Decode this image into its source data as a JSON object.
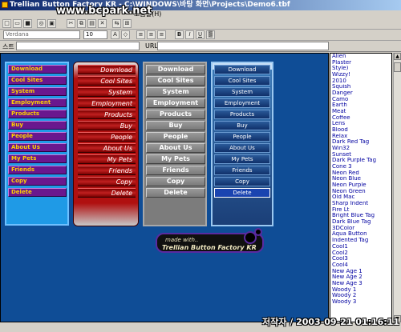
{
  "window": {
    "title": "Trellian Button Factory KR - C:\\WINDOWS\\바탕 화면\\Projects\\Demo6.tbf",
    "menu_tail": "도움말(H)"
  },
  "watermark": "www.bcpark.net",
  "toolbar": {
    "font_value": "Verdana",
    "size_value": "10"
  },
  "address": {
    "style_label": "스트",
    "url_label": "URL:",
    "style_value": "",
    "url_value": ""
  },
  "button_labels": [
    "Download",
    "Cool Sites",
    "System",
    "Employment",
    "Products",
    "Buy",
    "People",
    "About Us",
    "My Pets",
    "Friends",
    "Copy",
    "Delete"
  ],
  "credit": {
    "line1": "made with..",
    "line2": "Trellian Button Factory KR"
  },
  "styles": [
    "Alien",
    "Plaster",
    "Style)",
    "Wizzy!",
    "2010",
    "Squish",
    "Danger",
    "Camo",
    "Earth",
    "Meat",
    "Coffee",
    "Lens",
    "Blood",
    "Relax",
    "Dark Red Tag",
    "Win32",
    "Sunset",
    "Dark Purple Tag",
    "Cone 3",
    "Neon Red",
    "Neon Blue",
    "Neon Purple",
    "Neon Green",
    "Old Mac",
    "Sharp Indent",
    "Fire Lt",
    "Bright Blue Tag",
    "Dark Blue Tag",
    "3DColor",
    "Aqua Button",
    "Indented Tag",
    "Cool1",
    "Cool2",
    "Cool3",
    "Cool4",
    "New Age 1",
    "New Age 2",
    "New Age 3",
    "Woody 1",
    "Woody 2",
    "Woody 3"
  ],
  "stamp": "저작자 / 2003-09-21 01:16:11",
  "colors": {
    "canvas": "#0f4d96",
    "purple_button": "#6a178e",
    "purple_text": "#ffd000",
    "red_button": "#b01010",
    "gray_button": "#7c7c7c",
    "blue_button": "#1b3f78"
  }
}
